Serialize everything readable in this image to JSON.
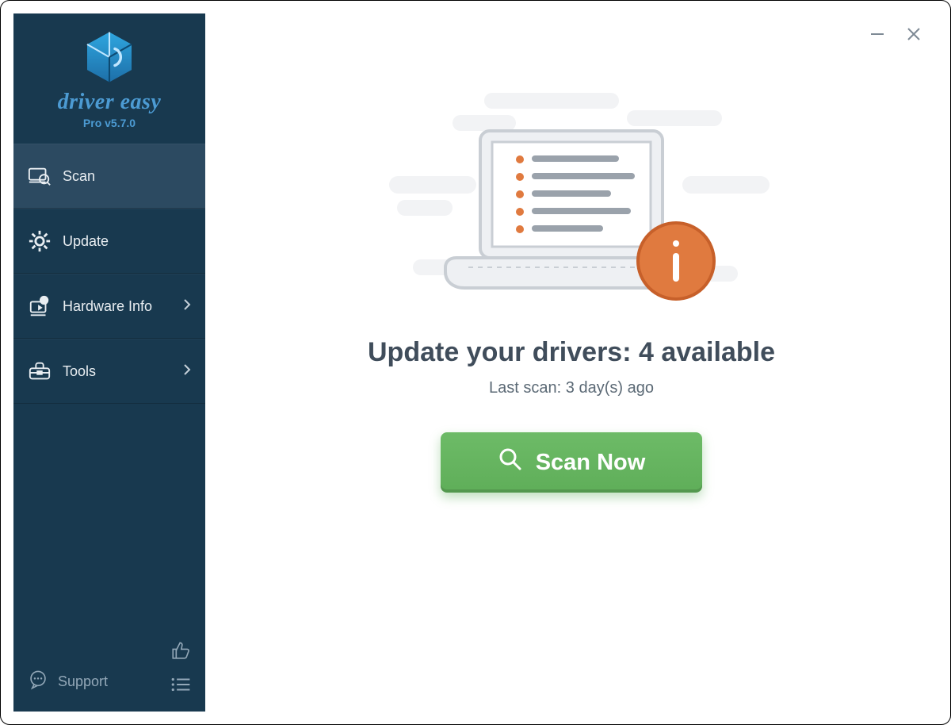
{
  "brand": {
    "product_name": "driver easy",
    "version_line": "Pro v5.7.0"
  },
  "sidebar": {
    "items": [
      {
        "label": "Scan",
        "icon": "scan-icon",
        "has_chevron": false,
        "active": true
      },
      {
        "label": "Update",
        "icon": "gear-icon",
        "has_chevron": false,
        "active": false
      },
      {
        "label": "Hardware Info",
        "icon": "hardware-icon",
        "has_chevron": true,
        "active": false
      },
      {
        "label": "Tools",
        "icon": "toolbox-icon",
        "has_chevron": true,
        "active": false
      }
    ],
    "support_label": "Support"
  },
  "main": {
    "headline": "Update your drivers: 4 available",
    "subline": "Last scan: 3 day(s) ago",
    "scan_button_label": "Scan Now"
  },
  "colors": {
    "sidebar_bg": "#18394f",
    "sidebar_active": "#2c4a61",
    "accent_blue": "#4c9bd3",
    "headline": "#404d5b",
    "info_orange": "#e07a3f",
    "scan_green": "#5fae59"
  }
}
